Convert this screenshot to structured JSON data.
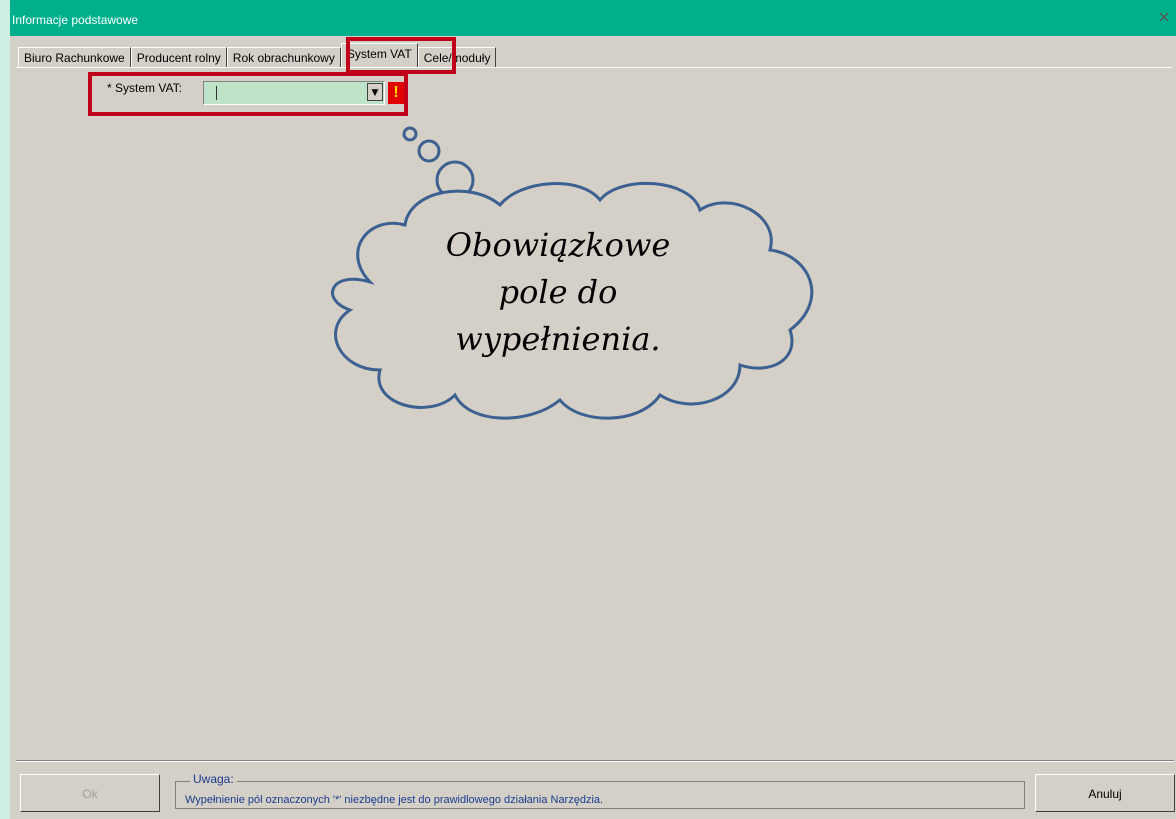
{
  "window": {
    "title": "Informacje podstawowe",
    "close_glyph": "×",
    "title_bar_color": "#00af8c"
  },
  "tabs": [
    {
      "label": "Biuro Rachunkowe",
      "active": false
    },
    {
      "label": "Producent rolny",
      "active": false
    },
    {
      "label": "Rok obrachunkowy",
      "active": false
    },
    {
      "label": "System VAT",
      "active": true
    },
    {
      "label": "Cele/moduły",
      "active": false
    }
  ],
  "form": {
    "vat_label": "* System VAT:",
    "vat_value": "",
    "dropdown_icon": "chevron-down-icon",
    "warning_glyph": "!"
  },
  "callout": {
    "line1": "Obowiązkowe",
    "line2": "pole do",
    "line3": "wypełnienia."
  },
  "footer": {
    "ok_label": "Ok",
    "cancel_label": "Anuluj",
    "note_title": "Uwaga:",
    "note_text": "Wypełnienie pól oznaczonych '*' niezbędne jest do prawidlowego działania Narzędzia."
  },
  "colors": {
    "highlight": "#c0001a",
    "cloud_stroke": "#3c6090",
    "note_text": "#1a3b8f"
  }
}
